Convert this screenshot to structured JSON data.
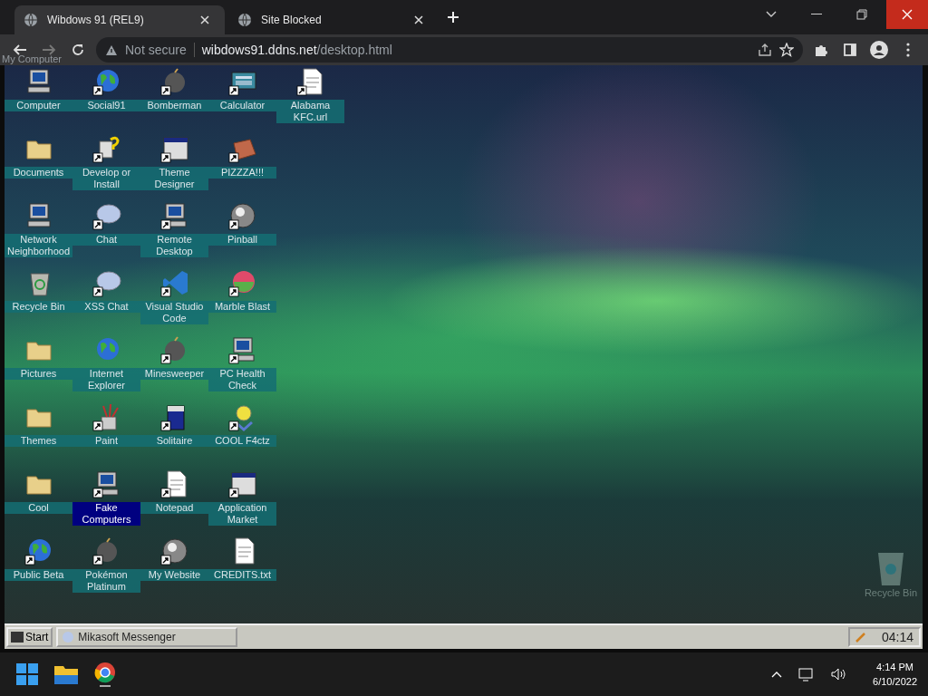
{
  "browser": {
    "tabs": [
      {
        "title": "Wibdows 91 (REL9)",
        "selected": true
      },
      {
        "title": "Site Blocked",
        "selected": false
      }
    ],
    "address": {
      "security": "Not secure",
      "host": "wibdows91.ddns.net",
      "path": "/desktop.html"
    }
  },
  "desktop": {
    "drag_label": "My Computer",
    "rows": [
      {
        "icons": [
          {
            "label": "Computer",
            "kind": "computer",
            "shortcut": false,
            "selected": false
          },
          {
            "label": "Social91",
            "kind": "globe",
            "shortcut": true,
            "selected": false
          },
          {
            "label": "Bomberman",
            "kind": "bomb",
            "shortcut": true,
            "selected": false
          },
          {
            "label": "Calculator",
            "kind": "calculator",
            "shortcut": true,
            "selected": false
          },
          {
            "label": "Alabama KFC.url",
            "kind": "document",
            "shortcut": true,
            "selected": false
          }
        ]
      },
      {
        "icons": [
          {
            "label": "Documents",
            "kind": "folder",
            "shortcut": false,
            "selected": false
          },
          {
            "label": "Develop or Install",
            "kind": "help",
            "shortcut": true,
            "selected": false
          },
          {
            "label": "Theme Designer",
            "kind": "window",
            "shortcut": true,
            "selected": false
          },
          {
            "label": "PIZZZA!!!",
            "kind": "pizza",
            "shortcut": true,
            "selected": false
          }
        ]
      },
      {
        "icons": [
          {
            "label": "Network Neighborhood",
            "kind": "computer",
            "shortcut": false,
            "selected": false
          },
          {
            "label": "Chat",
            "kind": "chat",
            "shortcut": true,
            "selected": false
          },
          {
            "label": "Remote Desktop",
            "kind": "computer",
            "shortcut": true,
            "selected": false
          },
          {
            "label": "Pinball",
            "kind": "ball",
            "shortcut": true,
            "selected": false
          }
        ]
      },
      {
        "icons": [
          {
            "label": "Recycle Bin",
            "kind": "bin",
            "shortcut": false,
            "selected": false
          },
          {
            "label": "XSS Chat",
            "kind": "chat",
            "shortcut": true,
            "selected": false
          },
          {
            "label": "Visual Studio Code",
            "kind": "code",
            "shortcut": true,
            "selected": false
          },
          {
            "label": "Marble Blast",
            "kind": "marble",
            "shortcut": true,
            "selected": false
          }
        ]
      },
      {
        "icons": [
          {
            "label": "Pictures",
            "kind": "folder",
            "shortcut": false,
            "selected": false
          },
          {
            "label": "Internet Explorer",
            "kind": "globe",
            "shortcut": false,
            "selected": false
          },
          {
            "label": "Minesweeper",
            "kind": "bomb",
            "shortcut": true,
            "selected": false
          },
          {
            "label": "PC Health Check",
            "kind": "computer",
            "shortcut": true,
            "selected": false
          }
        ]
      },
      {
        "icons": [
          {
            "label": "Themes",
            "kind": "folder",
            "shortcut": false,
            "selected": false
          },
          {
            "label": "Paint",
            "kind": "paint",
            "shortcut": true,
            "selected": false
          },
          {
            "label": "Solitaire",
            "kind": "cards",
            "shortcut": true,
            "selected": false
          },
          {
            "label": "COOL F4ctz",
            "kind": "bulb",
            "shortcut": true,
            "selected": false
          }
        ]
      },
      {
        "icons": [
          {
            "label": "Cool",
            "kind": "folder",
            "shortcut": false,
            "selected": false
          },
          {
            "label": "Fake Computers",
            "kind": "computer",
            "shortcut": true,
            "selected": true
          },
          {
            "label": "Notepad",
            "kind": "document",
            "shortcut": true,
            "selected": false
          },
          {
            "label": "Application Market",
            "kind": "window",
            "shortcut": true,
            "selected": false
          }
        ]
      },
      {
        "icons": [
          {
            "label": "Public Beta",
            "kind": "globe",
            "shortcut": true,
            "selected": false
          },
          {
            "label": "Pokémon Platinum",
            "kind": "bomb",
            "shortcut": true,
            "selected": false
          },
          {
            "label": "My Website",
            "kind": "ball",
            "shortcut": true,
            "selected": false
          },
          {
            "label": "CREDITS.txt",
            "kind": "document",
            "shortcut": false,
            "selected": false
          }
        ]
      }
    ],
    "ghost_icon": {
      "label": "Recycle Bin"
    }
  },
  "wibdows_taskbar": {
    "start": "Start",
    "windows": [
      {
        "label": "Mikasoft Messenger",
        "selected": false
      }
    ],
    "clock": "04:14"
  },
  "os_taskbar": {
    "time": "4:14 PM",
    "date": "6/10/2022"
  }
}
